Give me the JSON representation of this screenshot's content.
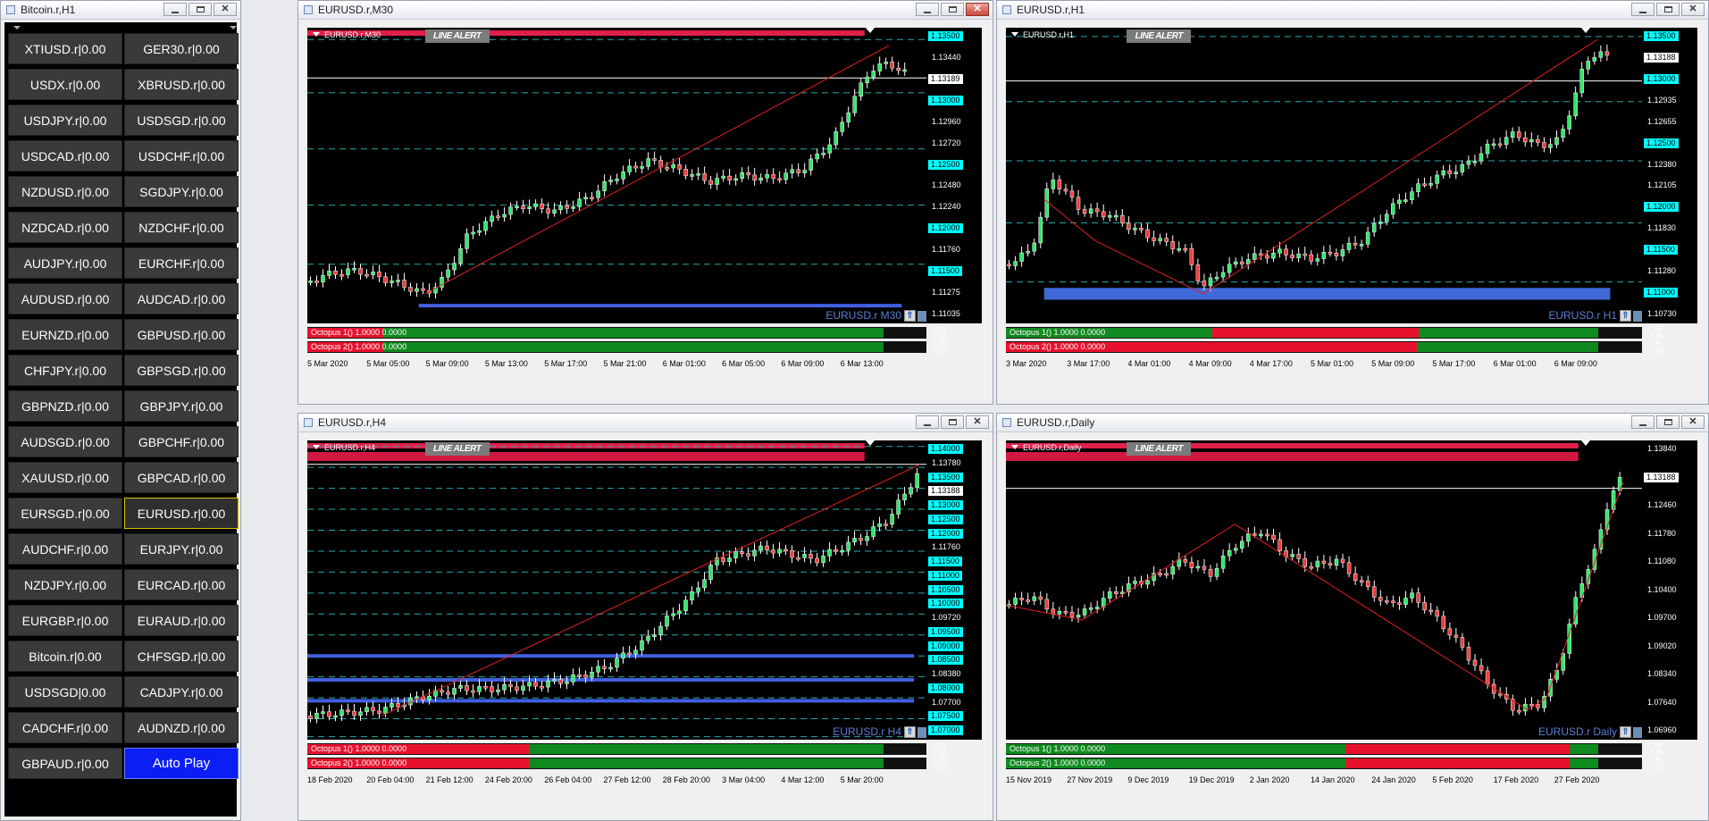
{
  "market_watch": {
    "title": "Bitcoin.r,H1",
    "pairs": [
      [
        "XTIUSD.r|0.00",
        "GER30.r|0.00"
      ],
      [
        "USDX.r|0.00",
        "XBRUSD.r|0.00"
      ],
      [
        "USDJPY.r|0.00",
        "USDSGD.r|0.00"
      ],
      [
        "USDCAD.r|0.00",
        "USDCHF.r|0.00"
      ],
      [
        "NZDUSD.r|0.00",
        "SGDJPY.r|0.00"
      ],
      [
        "NZDCAD.r|0.00",
        "NZDCHF.r|0.00"
      ],
      [
        "AUDJPY.r|0.00",
        "EURCHF.r|0.00"
      ],
      [
        "AUDUSD.r|0.00",
        "AUDCAD.r|0.00"
      ],
      [
        "EURNZD.r|0.00",
        "GBPUSD.r|0.00"
      ],
      [
        "CHFJPY.r|0.00",
        "GBPSGD.r|0.00"
      ],
      [
        "GBPNZD.r|0.00",
        "GBPJPY.r|0.00"
      ],
      [
        "AUDSGD.r|0.00",
        "GBPCHF.r|0.00"
      ],
      [
        "XAUUSD.r|0.00",
        "GBPCAD.r|0.00"
      ],
      [
        "EURSGD.r|0.00",
        "EURUSD.r|0.00"
      ],
      [
        "AUDCHF.r|0.00",
        "EURJPY.r|0.00"
      ],
      [
        "NZDJPY.r|0.00",
        "EURCAD.r|0.00"
      ],
      [
        "EURGBP.r|0.00",
        "EURAUD.r|0.00"
      ],
      [
        "Bitcoin.r|0.00",
        "CHFSGD.r|0.00"
      ],
      [
        "USDSGD|0.00",
        "CADJPY.r|0.00"
      ],
      [
        "CADCHF.r|0.00",
        "AUDNZD.r|0.00"
      ],
      [
        "GBPAUD.r|0.00",
        "Auto Play"
      ]
    ],
    "selected": "EURUSD.r|0.00",
    "auto_play_color": "#0b1ff5"
  },
  "common": {
    "line_alert": "LINE ALERT",
    "octopus1": "Octopus 1() 1.0000 0.0000",
    "octopus2": "Octopus 2() 1.0000 0.0000",
    "ind_top": "1.05",
    "ind_bot": "-0.05"
  },
  "charts": [
    {
      "id": "m30",
      "title": "EURUSD.r,M30",
      "symbol": "EURUSD.r,M30",
      "watermark": "EURUSD.r M30",
      "close_active": true,
      "price_labels": [
        {
          "t": "1.13500",
          "c": "cyan"
        },
        {
          "t": "1.13440",
          "c": "none"
        },
        {
          "t": "1.13189",
          "c": "white"
        },
        {
          "t": "1.13000",
          "c": "cyan"
        },
        {
          "t": "1.12960",
          "c": "none"
        },
        {
          "t": "1.12720",
          "c": "none"
        },
        {
          "t": "1.12500",
          "c": "cyan"
        },
        {
          "t": "1.12480",
          "c": "none"
        },
        {
          "t": "1.12240",
          "c": "none"
        },
        {
          "t": "1.12000",
          "c": "cyan"
        },
        {
          "t": "1.11760",
          "c": "none"
        },
        {
          "t": "1.11500",
          "c": "cyan"
        },
        {
          "t": "1.11275",
          "c": "none"
        },
        {
          "t": "1.11035",
          "c": "none"
        }
      ],
      "x_labels": [
        "5 Mar 2020",
        "5 Mar 05:00",
        "5 Mar 09:00",
        "5 Mar 13:00",
        "5 Mar 17:00",
        "5 Mar 21:00",
        "6 Mar 01:00",
        "6 Mar 05:00",
        "6 Mar 09:00",
        "6 Mar 13:00"
      ],
      "octo1": "rrrrrrrrrrrrggggggggggggggggggggggggggggggggggggggggggggggggggggggggggggggggggggggggggggggg",
      "octo2": "rrrrrrrrrrrrggggggggggggggggggggggggggggggggggggggggggggggggggggggggggggggggggggggggggggggg"
    },
    {
      "id": "h1",
      "title": "EURUSD.r,H1",
      "symbol": "EURUSD.r,H1",
      "watermark": "EURUSD.r H1",
      "close_active": false,
      "price_labels": [
        {
          "t": "1.13500",
          "c": "cyan"
        },
        {
          "t": "1.13188",
          "c": "white"
        },
        {
          "t": "1.13000",
          "c": "cyan"
        },
        {
          "t": "1.12935",
          "c": "none"
        },
        {
          "t": "1.12655",
          "c": "none"
        },
        {
          "t": "1.12500",
          "c": "cyan"
        },
        {
          "t": "1.12380",
          "c": "none"
        },
        {
          "t": "1.12105",
          "c": "none"
        },
        {
          "t": "1.12000",
          "c": "cyan"
        },
        {
          "t": "1.11830",
          "c": "none"
        },
        {
          "t": "1.11500",
          "c": "cyan"
        },
        {
          "t": "1.11280",
          "c": "none"
        },
        {
          "t": "1.11000",
          "c": "cyan"
        },
        {
          "t": "1.10730",
          "c": "none"
        }
      ],
      "x_labels": [
        "3 Mar 2020",
        "3 Mar 17:00",
        "4 Mar 01:00",
        "4 Mar 09:00",
        "4 Mar 17:00",
        "5 Mar 01:00",
        "5 Mar 09:00",
        "5 Mar 17:00",
        "6 Mar 01:00",
        "6 Mar 09:00"
      ],
      "octo1": "ggggggggggggggggggggggggggggggggggggggrrrrrrrrrrrrrrrrrrrrrrrrrrrrrrrrrrrrrrggggggggggggggggggggggggggggggggg",
      "octo2": "rrrrrrrrrrrrrrrrrrrrrrrrrrrrrrrrrrrrrrrrrrrrrrrrrrrrrrrrrrrrrrrrrrrrrrrrrrrggggggggggggggggggggggggggggggggg"
    },
    {
      "id": "h4",
      "title": "EURUSD.r,H4",
      "symbol": "EURUSD.r,H4",
      "watermark": "EURUSD.r H4",
      "close_active": false,
      "price_labels": [
        {
          "t": "1.14000",
          "c": "cyan"
        },
        {
          "t": "1.13780",
          "c": "none"
        },
        {
          "t": "1.13500",
          "c": "cyan"
        },
        {
          "t": "1.13188",
          "c": "white"
        },
        {
          "t": "1.13000",
          "c": "cyan"
        },
        {
          "t": "1.12500",
          "c": "cyan"
        },
        {
          "t": "1.12000",
          "c": "cyan"
        },
        {
          "t": "1.11760",
          "c": "none"
        },
        {
          "t": "1.11500",
          "c": "cyan"
        },
        {
          "t": "1.11000",
          "c": "cyan"
        },
        {
          "t": "1.10500",
          "c": "cyan"
        },
        {
          "t": "1.10000",
          "c": "cyan"
        },
        {
          "t": "1.09720",
          "c": "none"
        },
        {
          "t": "1.09500",
          "c": "cyan"
        },
        {
          "t": "1.09000",
          "c": "cyan"
        },
        {
          "t": "1.08500",
          "c": "cyan"
        },
        {
          "t": "1.08380",
          "c": "none"
        },
        {
          "t": "1.08000",
          "c": "cyan"
        },
        {
          "t": "1.07700",
          "c": "none"
        },
        {
          "t": "1.07500",
          "c": "cyan"
        },
        {
          "t": "1.07000",
          "c": "cyan"
        }
      ],
      "x_labels": [
        "18 Feb 2020",
        "20 Feb 04:00",
        "21 Feb 12:00",
        "24 Feb 20:00",
        "26 Feb 04:00",
        "27 Feb 12:00",
        "28 Feb 20:00",
        "3 Mar 04:00",
        "4 Mar 12:00",
        "5 Mar 20:00"
      ],
      "octo1": "rrrrrrrrrrrrrrrrrrrrrrrrrrrrrrrrrrrrrrrrrrrrrrrrrrrrrrrrrrggggggggggggggggggggggggggggggggggggggggggggggggggggggggggggggggggggggggggggggggggggggggggggg",
      "octo2": "rrrrrrrrrrrrrrrrrrrrrrrrrrrrrrrrrrrrrrrrrrrrrrrrrrrrrrrrrrggggggggggggggggggggggggggggggggggggggggggggggggggggggggggggggggggggggggggggggggggggggggggggg"
    },
    {
      "id": "d1",
      "title": "EURUSD.r,Daily",
      "symbol": "EURUSD.r,Daily",
      "watermark": "EURUSD.r Daily",
      "close_active": false,
      "price_labels": [
        {
          "t": "1.13840",
          "c": "none"
        },
        {
          "t": "1.13188",
          "c": "white"
        },
        {
          "t": "1.12460",
          "c": "none"
        },
        {
          "t": "1.11780",
          "c": "none"
        },
        {
          "t": "1.11080",
          "c": "none"
        },
        {
          "t": "1.10400",
          "c": "none"
        },
        {
          "t": "1.09700",
          "c": "none"
        },
        {
          "t": "1.09020",
          "c": "none"
        },
        {
          "t": "1.08340",
          "c": "none"
        },
        {
          "t": "1.07640",
          "c": "none"
        },
        {
          "t": "1.06960",
          "c": "none"
        }
      ],
      "x_labels": [
        "15 Nov 2019",
        "27 Nov 2019",
        "9 Dec 2019",
        "19 Dec 2019",
        "2 Jan 2020",
        "14 Jan 2020",
        "24 Jan 2020",
        "5 Feb 2020",
        "17 Feb 2020",
        "27 Feb 2020"
      ],
      "octo1": "gggggggggggggggggggggggggggggggggggggggggggggggggggggggggggggggggggggggggggggggggggggggggggggggggrrrrrrrrrrrrrrrrrrrrrrrrrrrrrrrrrrrrrrrrrrrrrrrrrrrrrrrrrrrrrrrrgggggggg",
      "octo2": "gggggggggggggggggggggggggggggggggggggggggggggggggggggggggggggggggggggggggggggggggggggggggggggggggrrrrrrrrrrrrrrrrrrrrrrrrrrrrrrrrrrrrrrrrrrrrrrrrrrrrrrrrrrrrrrrrgggggggg"
    }
  ]
}
